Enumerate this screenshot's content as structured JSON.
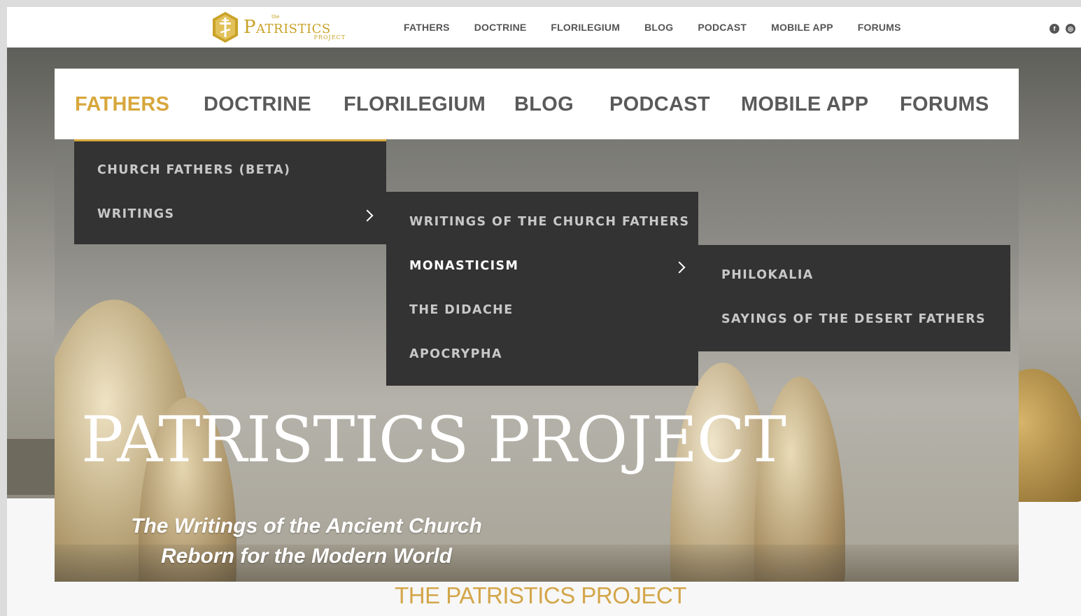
{
  "site": {
    "logo": {
      "small": "the",
      "name": "Patristics",
      "sub": "PROJECT"
    },
    "top_nav": [
      "FATHERS",
      "DOCTRINE",
      "FLORILEGIUM",
      "BLOG",
      "PODCAST",
      "MOBILE APP",
      "FORUMS"
    ],
    "social": [
      {
        "icon": "facebook-icon",
        "glyph": "f"
      },
      {
        "icon": "instagram-icon",
        "glyph": "◎"
      }
    ]
  },
  "main_nav": {
    "items": [
      "FATHERS",
      "DOCTRINE",
      "FLORILEGIUM",
      "BLOG",
      "PODCAST",
      "MOBILE APP",
      "FORUMS"
    ],
    "active": "FATHERS"
  },
  "menus": {
    "level1": [
      "CHURCH FATHERS (BETA)",
      "WRITINGS"
    ],
    "level2": [
      "WRITINGS OF THE CHURCH FATHERS",
      "MONASTICISM",
      "THE DIDACHE",
      "APOCRYPHA"
    ],
    "level3": [
      "PHILOKALIA",
      "SAYINGS OF THE DESERT FATHERS"
    ],
    "highlighted": "MONASTICISM"
  },
  "hero": {
    "title": "PATRISTICS PROJECT",
    "tagline_line1": "The Writings of the Ancient Church",
    "tagline_line2": "Reborn for the Modern World"
  },
  "footer_heading": "THE PATRISTICS PROJECT",
  "colors": {
    "accent": "#d7a73c",
    "menu_bg": "#333333",
    "nav_text": "#5a5a5a"
  }
}
